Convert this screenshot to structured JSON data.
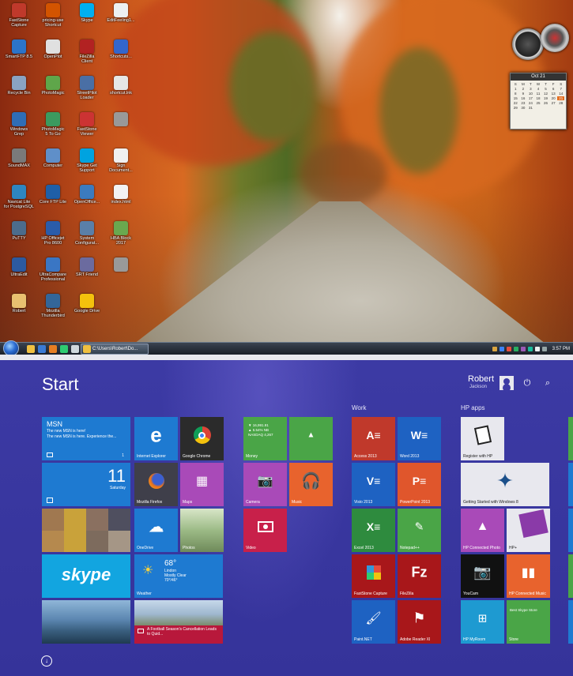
{
  "desktop": {
    "icons": [
      {
        "label": "FastStone\nCapture",
        "color": "#c0392b"
      },
      {
        "label": "pricing-use\nShortcut",
        "color": "#d35400"
      },
      {
        "label": "Skype",
        "color": "#00aff0"
      },
      {
        "label": "EditFeeling1...",
        "color": "#ecf0f1"
      },
      {
        "label": "SmartFTP 8.5",
        "color": "#2c74c9"
      },
      {
        "label": "OpenPlot",
        "color": "#e0e0e0"
      },
      {
        "label": "FileZilla\nClient",
        "color": "#b22222"
      },
      {
        "label": "Shortcuts...",
        "color": "#3366cc"
      },
      {
        "label": "Recycle Bin",
        "color": "#8aa3c2"
      },
      {
        "label": "PhotoMagic",
        "color": "#5fa64a"
      },
      {
        "label": "StreetPilot Loader",
        "color": "#4a6fa5"
      },
      {
        "label": "shortcut.lnk",
        "color": "#e6e6e6"
      },
      {
        "label": "Windows\nGrep",
        "color": "#2f6db5"
      },
      {
        "label": "PhotoMagic\n5 To Go",
        "color": "#3c9a5f"
      },
      {
        "label": "FastStone\nViewer",
        "color": "#cc3333"
      },
      {
        "label": "",
        "color": "#999999"
      },
      {
        "label": "SoundMAX",
        "color": "#7a7a7a"
      },
      {
        "label": "Computer",
        "color": "#5f8fc9"
      },
      {
        "label": "Skype Get\nSupport",
        "color": "#00a3e0"
      },
      {
        "label": "Sign\nDocument...",
        "color": "#f0f0f0"
      },
      {
        "label": "Navicat Lite\nfor PostgreSQL",
        "color": "#2e86c1"
      },
      {
        "label": "Core FTP Lite",
        "color": "#1f5fa8"
      },
      {
        "label": "OpenOffice...",
        "color": "#3b7bbf"
      },
      {
        "label": "index.html",
        "color": "#f2f2f2"
      },
      {
        "label": "PuTTY",
        "color": "#4c6c8c"
      },
      {
        "label": "HP Officejet\nPro 8600",
        "color": "#2a5caa"
      },
      {
        "label": "System\nConfigurat...",
        "color": "#5a7fa8"
      },
      {
        "label": "HBA Block\n2017",
        "color": "#6aa84f"
      },
      {
        "label": "UltraEdit",
        "color": "#2c5aa0"
      },
      {
        "label": "UltraCompare\nProfessional",
        "color": "#3a76c4"
      },
      {
        "label": "SRT Friend",
        "color": "#6b6b9f"
      },
      {
        "label": "",
        "color": "#999999"
      },
      {
        "label": "Robert",
        "color": "#e8c070"
      },
      {
        "label": "Mozilla\nThunderbird",
        "color": "#336699"
      },
      {
        "label": "Google Drive",
        "color": "#f4c20d"
      }
    ],
    "calendar": {
      "month": "Oct 21",
      "days": [
        "S",
        "M",
        "T",
        "W",
        "T",
        "F",
        "S",
        "1",
        "2",
        "3",
        "4",
        "5",
        "6",
        "7",
        "8",
        "9",
        "10",
        "11",
        "12",
        "13",
        "14",
        "15",
        "16",
        "17",
        "18",
        "19",
        "20",
        "21",
        "22",
        "23",
        "24",
        "25",
        "26",
        "27",
        "28",
        "29",
        "30",
        "31"
      ]
    },
    "taskbar": {
      "explorer_label": "C:\\Users\\Robert\\Do...",
      "clock": "3:57 PM"
    }
  },
  "start": {
    "title": "Start",
    "user_name": "Robert",
    "user_sub": "Jackson",
    "power_icon": "power-icon",
    "search_icon": "search-icon",
    "group_work": "Work",
    "group_hp": "HP apps",
    "tiles": {
      "msn": {
        "title": "MSN",
        "line1": "The new MSN is here!",
        "line2": "The new MSN is here. Experience the...",
        "badge": "1"
      },
      "ie": "Internet Explorer",
      "chrome": "Google Chrome",
      "calendar_day": "11",
      "calendar_weekday": "Saturday",
      "firefox": "Mozilla Firefox",
      "maps": "Maps",
      "onedrive": "OneDrive",
      "photos": "Photos",
      "skype": "skype",
      "weather_temp": "68°",
      "weather_city": "Lindon",
      "weather_desc": "Mostly Clear",
      "weather_range": "70°/46°",
      "weather": "Weather",
      "news_caption": "A Football Season's Cancellation Leads to Quid...",
      "money_line1": "▼ 16,991.91",
      "money_line2": "▲ 5.54%  NB",
      "money_line3": "NASDAQ 4,267",
      "money": "Money",
      "camera": "Camera",
      "music": "Music",
      "video": "Video",
      "access": "Access 2013",
      "word": "Word 2013",
      "visio": "Visio 2013",
      "powerpoint": "PowerPoint 2013",
      "excel": "Excel 2013",
      "notepad": "Notepad++",
      "faststone": "FastStone Capture",
      "filezilla": "FileZilla",
      "paintnet": "Paint.NET",
      "adobe": "Adobe Reader XI",
      "register": "Register with HP",
      "getting_started": "Getting Started with Windows 8",
      "hp_photo": "HP Connected Photo",
      "hp_plus": "HP+",
      "youcam": "YouCam",
      "hp_music": "HP Connected Music",
      "hp_myroom": "HP MyRoom",
      "store_line": "Best Skype Store",
      "store": "Store"
    }
  },
  "colors": {
    "start_bg": "#3c3aa4",
    "blue": "#1e7ad1",
    "dark": "#2b2b2b",
    "green": "#4aa547",
    "magenta": "#a94ab8",
    "red": "#d13535",
    "orange": "#e8632d",
    "accent_crimson": "#b8183b"
  }
}
